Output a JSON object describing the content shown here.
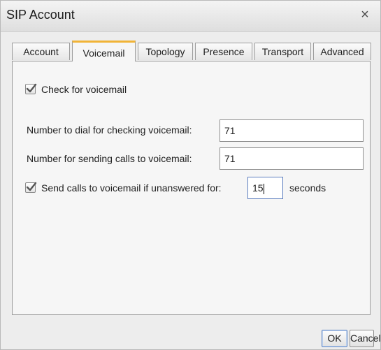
{
  "window": {
    "title": "SIP Account",
    "close_symbol": "×"
  },
  "tabs": [
    {
      "label": "Account",
      "active": false
    },
    {
      "label": "Voicemail",
      "active": true
    },
    {
      "label": "Topology",
      "active": false
    },
    {
      "label": "Presence",
      "active": false
    },
    {
      "label": "Transport",
      "active": false
    },
    {
      "label": "Advanced",
      "active": false
    }
  ],
  "voicemail": {
    "check_for_voicemail": {
      "label": "Check for voicemail",
      "checked": true
    },
    "dial_number": {
      "label": "Number to dial for checking voicemail:",
      "value": "71"
    },
    "send_number": {
      "label": "Number for sending calls to voicemail:",
      "value": "71"
    },
    "unanswered": {
      "label": "Send calls to voicemail if unanswered for:",
      "checked": true,
      "value": "15",
      "unit": "seconds"
    }
  },
  "buttons": {
    "ok": "OK",
    "cancel": "Cancel"
  }
}
